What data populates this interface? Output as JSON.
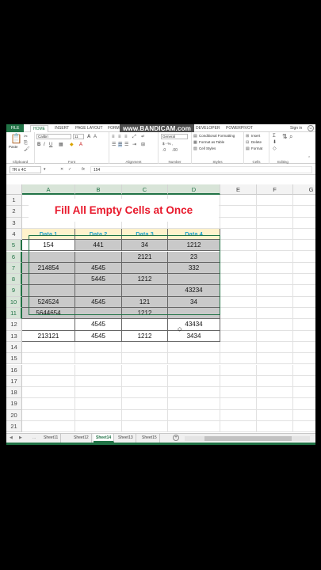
{
  "ribbon_tabs": [
    "FILE",
    "HOME",
    "INSERT",
    "PAGE LAYOUT",
    "FORM",
    "DEVELOPER",
    "POWERPIVOT"
  ],
  "sign_in": "Sign in",
  "watermark": "www.BANDICAM.com",
  "ribbon": {
    "paste": "Paste",
    "clipboard": "Clipboard",
    "font_name": "Calibri",
    "font_size": "11",
    "font": "Font",
    "alignment": "Alignment",
    "number_format": "General",
    "number_symbols": "$ - % ,",
    "number": "Number",
    "conditional_formatting": "Conditional Formatting",
    "format_as_table": "Format as Table",
    "cell_styles": "Cell Styles",
    "styles": "Styles",
    "insert": "Insert",
    "delete": "Delete",
    "format": "Format",
    "cells": "Cells",
    "editing": "Editing"
  },
  "formula_bar": {
    "name_box": "7R x 4C",
    "fx": "fx",
    "value": "154"
  },
  "columns": [
    "A",
    "B",
    "C",
    "D",
    "E",
    "F",
    "G"
  ],
  "rows": [
    "1",
    "2",
    "3",
    "4",
    "5",
    "6",
    "7",
    "8",
    "9",
    "10",
    "11",
    "12",
    "13",
    "14",
    "15",
    "16",
    "17",
    "18",
    "19",
    "20",
    "21"
  ],
  "title": "Fill All Empty Cells at Once",
  "table": {
    "headers": [
      "Data 1",
      "Data 2",
      "Data 3",
      "Data 4"
    ],
    "rows": [
      [
        "154",
        "441",
        "34",
        "1212"
      ],
      [
        "",
        "",
        "2121",
        "23"
      ],
      [
        "214854",
        "4545",
        "",
        "332"
      ],
      [
        "",
        "5445",
        "1212",
        ""
      ],
      [
        "",
        "",
        "",
        "43234"
      ],
      [
        "524524",
        "4545",
        "121",
        "34"
      ],
      [
        "5644654",
        "",
        "1212",
        ""
      ],
      [
        "",
        "4545",
        "",
        "43434"
      ],
      [
        "213121",
        "4545",
        "1212",
        "3434"
      ]
    ]
  },
  "sheets": [
    "Sheet11",
    "Sheet12",
    "Sheet14",
    "Sheet13",
    "Sheet15"
  ],
  "active_sheet": "Sheet14",
  "sheet_nav": [
    "◀",
    "▶",
    "..."
  ],
  "colors": {
    "excel_green": "#217346",
    "title_red": "#e8192c",
    "header_fill": "#fff2cc",
    "header_text": "#1fa1c9",
    "selection_grey": "#c9c9c9"
  }
}
